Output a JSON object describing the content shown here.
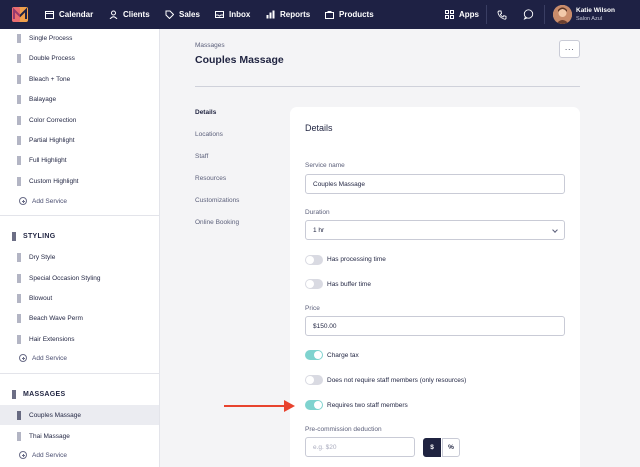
{
  "topbar": {
    "nav": [
      "Calendar",
      "Clients",
      "Sales",
      "Inbox",
      "Reports",
      "Products"
    ],
    "apps_label": "Apps",
    "user_name": "Katie Wilson",
    "user_salon": "Salon Azul"
  },
  "sidebar": {
    "group1_items": [
      "Single Process",
      "Double Process",
      "Bleach + Tone",
      "Balayage",
      "Color Correction",
      "Partial Highlight",
      "Full Highlight",
      "Custom Highlight"
    ],
    "add_service": "Add Service",
    "styling_title": "STYLING",
    "styling_items": [
      "Dry Style",
      "Special Occasion Styling",
      "Blowout",
      "Beach Wave Perm",
      "Hair Extensions"
    ],
    "massages_title": "MASSAGES",
    "massages_items": [
      "Couples Massage",
      "Thai Massage"
    ],
    "selected": "Couples Massage"
  },
  "main": {
    "breadcrumb": "Massages",
    "title": "Couples Massage",
    "more_label": "···",
    "subnav": [
      "Details",
      "Locations",
      "Staff",
      "Resources",
      "Customizations",
      "Online Booking"
    ],
    "active_subnav": "Details"
  },
  "details": {
    "title": "Details",
    "service_name_label": "Service name",
    "service_name_value": "Couples Massage",
    "duration_label": "Duration",
    "duration_value": "1 hr",
    "processing_label": "Has processing time",
    "processing_on": false,
    "buffer_label": "Has buffer time",
    "buffer_on": false,
    "price_label": "Price",
    "price_value": "$150.00",
    "charge_tax_label": "Charge tax",
    "charge_tax_on": true,
    "no_staff_label": "Does not require staff members (only resources)",
    "no_staff_on": false,
    "two_staff_label": "Requires two staff members",
    "two_staff_on": true,
    "commission_label": "Pre-commission deduction",
    "commission_placeholder": "e.g. $20",
    "unit_dollar": "$",
    "unit_percent": "%"
  },
  "colors": {
    "topbar": "#1e2144",
    "toggle_on": "#7fd3cf",
    "arrow": "#e8432e"
  }
}
